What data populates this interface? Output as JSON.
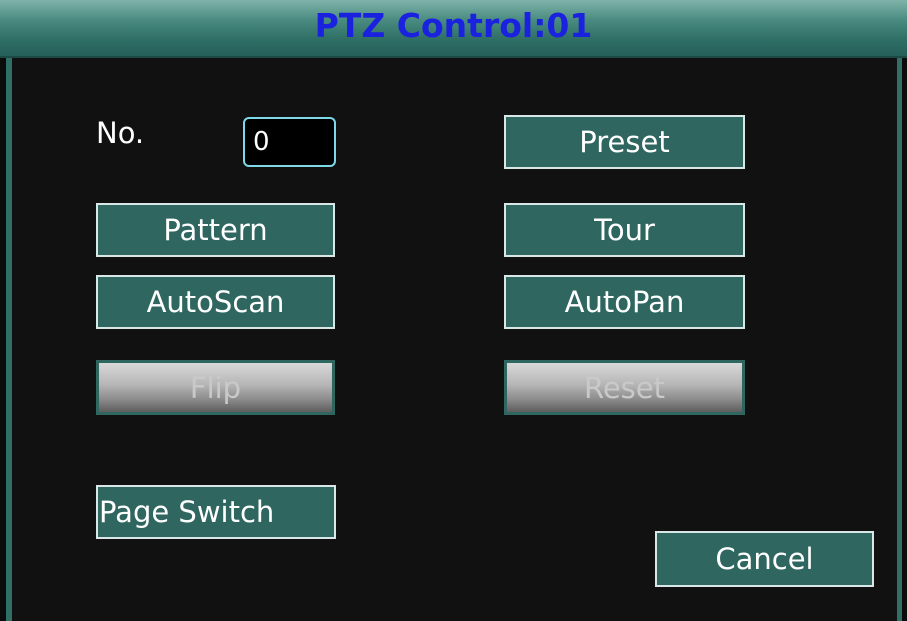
{
  "dialog": {
    "title": "PTZ Control:01"
  },
  "fields": {
    "no_label": "No.",
    "no_value": "0"
  },
  "buttons": {
    "preset": "Preset",
    "pattern": "Pattern",
    "tour": "Tour",
    "autoscan": "AutoScan",
    "autopan": "AutoPan",
    "flip": "Flip",
    "reset": "Reset",
    "page_switch": "Page Switch",
    "cancel": "Cancel"
  },
  "colors": {
    "title_text": "#1a22e0",
    "button_bg": "#2f6660",
    "background": "#111111",
    "input_border": "#7fd8e8"
  }
}
